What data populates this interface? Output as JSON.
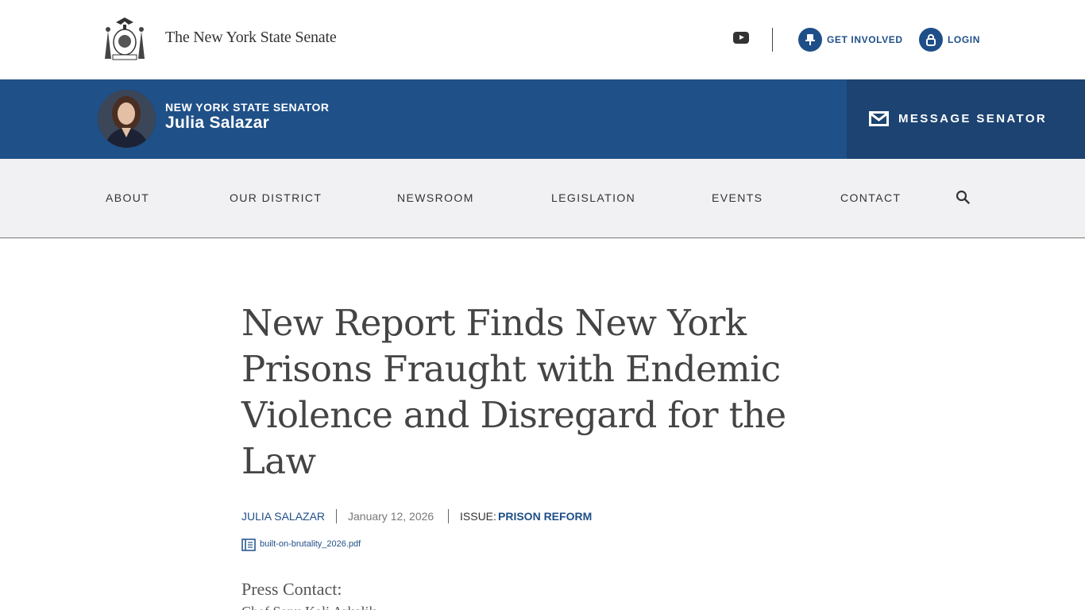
{
  "header": {
    "site_title": "The New York State Senate",
    "get_involved_label": "GET INVOLVED",
    "login_label": "LOGIN"
  },
  "senator": {
    "kicker": "NEW YORK STATE SENATOR",
    "name": "Julia Salazar",
    "message_label": "MESSAGE SENATOR"
  },
  "nav": {
    "items": [
      "ABOUT",
      "OUR DISTRICT",
      "NEWSROOM",
      "LEGISLATION",
      "EVENTS",
      "CONTACT"
    ]
  },
  "article": {
    "title": "New Report Finds New York Prisons Fraught with Endemic Violence and Disregard for the Law",
    "author": "JULIA SALAZAR",
    "date": "January 12, 2026",
    "issue_label": "ISSUE:",
    "issue": "PRISON REFORM",
    "attachment": "built-on-brutality_2026.pdf",
    "press_contact_label": "Press Contact:",
    "press_contact_name": "Chef Sanu Kali Arkalik"
  },
  "colors": {
    "brand_blue": "#1f5088",
    "message_bg": "#1c4371",
    "nav_bg": "#f1f1f3"
  }
}
